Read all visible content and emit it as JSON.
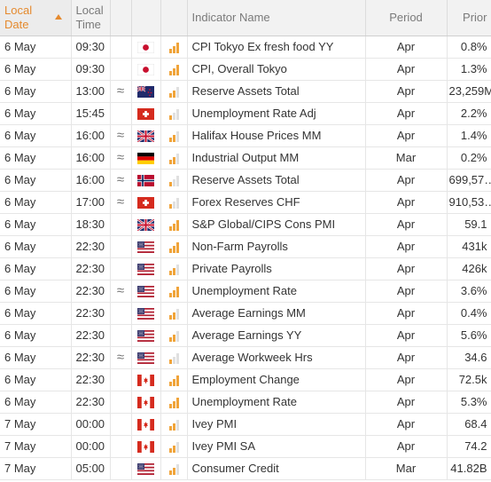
{
  "header": {
    "local_date": "Local Date",
    "local_time": "Local Time",
    "indicator_name": "Indicator Name",
    "period": "Period",
    "prior": "Prior"
  },
  "rows": [
    {
      "date": "6 May",
      "time": "09:30",
      "approx": "",
      "country": "jp",
      "impact": 3,
      "name": "CPI Tokyo Ex fresh food YY",
      "period": "Apr",
      "prior": "0.8%"
    },
    {
      "date": "6 May",
      "time": "09:30",
      "approx": "",
      "country": "jp",
      "impact": 3,
      "name": "CPI, Overall Tokyo",
      "period": "Apr",
      "prior": "1.3%"
    },
    {
      "date": "6 May",
      "time": "13:00",
      "approx": "≈",
      "country": "nz",
      "impact": 2,
      "name": "Reserve Assets Total",
      "period": "Apr",
      "prior": "23,259M"
    },
    {
      "date": "6 May",
      "time": "15:45",
      "approx": "",
      "country": "ch",
      "impact": 1,
      "name": "Unemployment Rate Adj",
      "period": "Apr",
      "prior": "2.2%"
    },
    {
      "date": "6 May",
      "time": "16:00",
      "approx": "≈",
      "country": "gb",
      "impact": 2,
      "name": "Halifax House Prices MM",
      "period": "Apr",
      "prior": "1.4%"
    },
    {
      "date": "6 May",
      "time": "16:00",
      "approx": "≈",
      "country": "de",
      "impact": 2,
      "name": "Industrial Output MM",
      "period": "Mar",
      "prior": "0.2%"
    },
    {
      "date": "6 May",
      "time": "16:00",
      "approx": "≈",
      "country": "no",
      "impact": 1,
      "name": "Reserve Assets Total",
      "period": "Apr",
      "prior": "699,57…"
    },
    {
      "date": "6 May",
      "time": "17:00",
      "approx": "≈",
      "country": "ch",
      "impact": 1,
      "name": "Forex Reserves CHF",
      "period": "Apr",
      "prior": "910,53…"
    },
    {
      "date": "6 May",
      "time": "18:30",
      "approx": "",
      "country": "gb",
      "impact": 3,
      "name": "S&P Global/CIPS Cons PMI",
      "period": "Apr",
      "prior": "59.1"
    },
    {
      "date": "6 May",
      "time": "22:30",
      "approx": "",
      "country": "us",
      "impact": 3,
      "name": "Non-Farm Payrolls",
      "period": "Apr",
      "prior": "431k"
    },
    {
      "date": "6 May",
      "time": "22:30",
      "approx": "",
      "country": "us",
      "impact": 2,
      "name": "Private Payrolls",
      "period": "Apr",
      "prior": "426k"
    },
    {
      "date": "6 May",
      "time": "22:30",
      "approx": "≈",
      "country": "us",
      "impact": 3,
      "name": "Unemployment Rate",
      "period": "Apr",
      "prior": "3.6%"
    },
    {
      "date": "6 May",
      "time": "22:30",
      "approx": "",
      "country": "us",
      "impact": 2,
      "name": "Average Earnings MM",
      "period": "Apr",
      "prior": "0.4%"
    },
    {
      "date": "6 May",
      "time": "22:30",
      "approx": "",
      "country": "us",
      "impact": 2,
      "name": "Average Earnings YY",
      "period": "Apr",
      "prior": "5.6%"
    },
    {
      "date": "6 May",
      "time": "22:30",
      "approx": "≈",
      "country": "us",
      "impact": 1,
      "name": "Average Workweek Hrs",
      "period": "Apr",
      "prior": "34.6"
    },
    {
      "date": "6 May",
      "time": "22:30",
      "approx": "",
      "country": "ca",
      "impact": 3,
      "name": "Employment Change",
      "period": "Apr",
      "prior": "72.5k"
    },
    {
      "date": "6 May",
      "time": "22:30",
      "approx": "",
      "country": "ca",
      "impact": 3,
      "name": "Unemployment Rate",
      "period": "Apr",
      "prior": "5.3%"
    },
    {
      "date": "7 May",
      "time": "00:00",
      "approx": "",
      "country": "ca",
      "impact": 2,
      "name": "Ivey PMI",
      "period": "Apr",
      "prior": "68.4"
    },
    {
      "date": "7 May",
      "time": "00:00",
      "approx": "",
      "country": "ca",
      "impact": 2,
      "name": "Ivey PMI SA",
      "period": "Apr",
      "prior": "74.2"
    },
    {
      "date": "7 May",
      "time": "05:00",
      "approx": "",
      "country": "us",
      "impact": 2,
      "name": "Consumer Credit",
      "period": "Mar",
      "prior": "41.82B"
    }
  ],
  "colors": {
    "accent": "#e58a2e",
    "impact_bar": "#f0a43a"
  }
}
